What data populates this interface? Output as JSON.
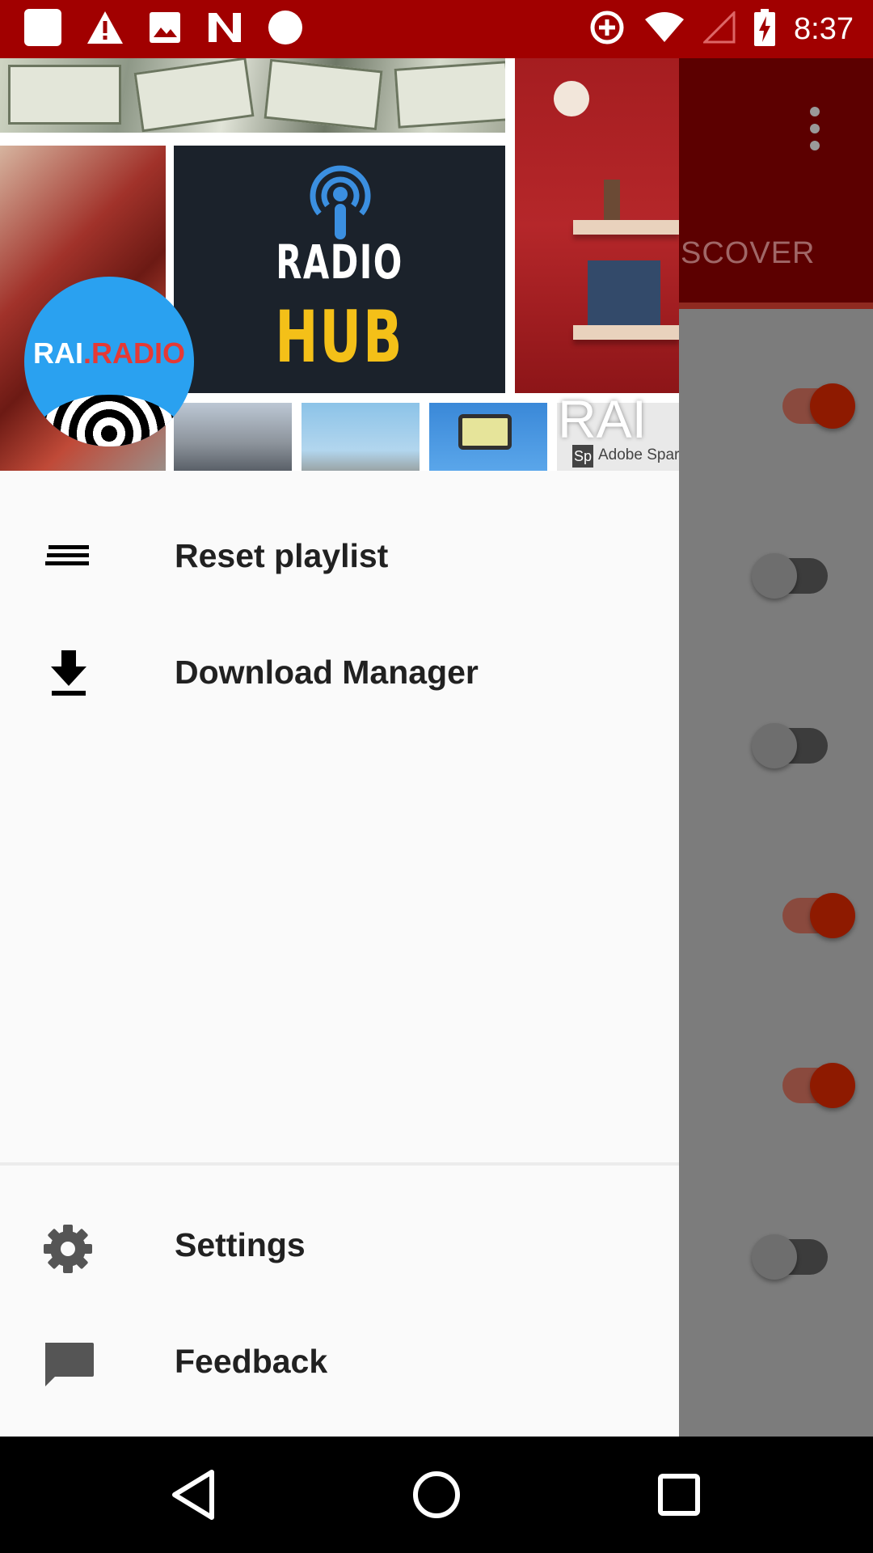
{
  "status_bar": {
    "time": "8:37",
    "left_icons": [
      "app-notification-icon",
      "warning-icon",
      "image-icon",
      "n-logo-icon",
      "circle-icon"
    ],
    "right_icons": [
      "data-saver-icon",
      "wifi-icon",
      "no-signal-icon",
      "battery-charging-icon"
    ]
  },
  "header": {
    "avatar_text_main": "RAI",
    "avatar_text_accent": ".RADIO",
    "radio_hub_line1": "RADIO",
    "radio_hub_line2": "HUB",
    "overlay_text": "RAI",
    "spark_logo": "Sp",
    "spark_label": "Adobe Spark"
  },
  "drawer": {
    "menu_items": [
      {
        "label": "Reset playlist",
        "icon": "playlist-icon"
      },
      {
        "label": "Download Manager",
        "icon": "download-icon"
      }
    ],
    "footer_items": [
      {
        "label": "Settings",
        "icon": "gear-icon"
      },
      {
        "label": "Feedback",
        "icon": "feedback-icon"
      }
    ]
  },
  "background_app": {
    "tab_label": "SCOVER",
    "switches": [
      true,
      false,
      false,
      true,
      true,
      false
    ],
    "colors": {
      "toolbar": "#5c0000",
      "switch_on": "#8e1a00"
    }
  },
  "navigation_bar": {
    "buttons": [
      "back-icon",
      "home-icon",
      "recents-icon"
    ]
  },
  "colors": {
    "status_bar": "#a10000",
    "drawer_bg": "#fafafa",
    "avatar_bg": "#2aa1f0",
    "hub_yellow": "#f4c018"
  }
}
